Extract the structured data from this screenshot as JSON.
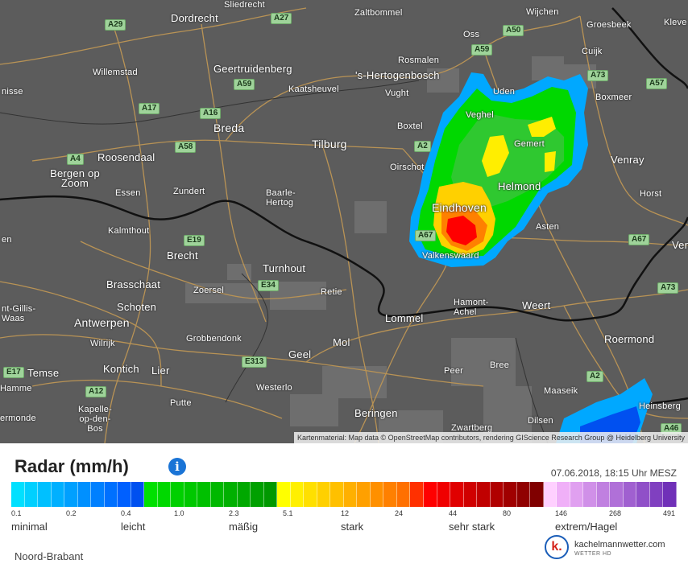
{
  "map": {
    "attribution": "Kartenmaterial: Map data © OpenStreetMap contributors, rendering GIScience Research Group @ Heidelberg University",
    "cities": [
      "Sliedrecht",
      "Dordrecht",
      "Zaltbommel",
      "Wijchen",
      "Kleve",
      "Oss",
      "Groesbeek",
      "Willemstad",
      "Geertruidenberg",
      "Rosmalen",
      "'s-Hertogenbosch",
      "Cuijk",
      "nisse",
      "Kaatsheuvel",
      "Vught",
      "Uden",
      "Boxmeer",
      "Breda",
      "Veghel",
      "Tilburg",
      "Boxtel",
      "Gemert",
      "Roosendaal",
      "Bergen op Zoom",
      "Oirschot",
      "Venray",
      "Essen",
      "Zundert",
      "Baarle-Hertog",
      "Helmond",
      "Horst",
      "Eindhoven",
      "Kalmthout",
      "Asten",
      "Brecht",
      "Valkenswaard",
      "Venlo",
      "Turnhout",
      "Brasschaat",
      "Zoersel",
      "Retie",
      "Schoten",
      "Hamont-Achel",
      "Weert",
      "nt-Gillis-Waas",
      "Antwerpen",
      "Lommel",
      "Wilrijk",
      "Grobbendonk",
      "Roermond",
      "Mol",
      "Geel",
      "Temse",
      "Kontich",
      "Lier",
      "Peer",
      "Bree",
      "Hamme",
      "Westerlo",
      "Maaseik",
      "Putte",
      "Kapelle-op-den-Bos",
      "Heinsberg",
      "Beringen",
      "Dilsen",
      "ermonde",
      "Zwartberg",
      "en"
    ],
    "roads": [
      "A29",
      "A27",
      "A50",
      "A59",
      "A73",
      "A57",
      "A59",
      "A17",
      "A16",
      "A58",
      "A4",
      "A2",
      "E19",
      "E34",
      "A67",
      "A67",
      "A73",
      "E313",
      "E17",
      "A12",
      "A2",
      "A46"
    ]
  },
  "legend": {
    "title": "Radar (mm/h)",
    "timestamp": "07.06.2018, 18:15 Uhr MESZ",
    "ticks": [
      "0.1",
      "0.2",
      "0.4",
      "1.0",
      "2.3",
      "5.1",
      "12",
      "24",
      "44",
      "80",
      "146",
      "268",
      "491"
    ],
    "categories": [
      "minimal",
      "leicht",
      "mäßig",
      "stark",
      "sehr stark",
      "extrem/Hagel"
    ],
    "colors": [
      "#00e0ff",
      "#00d0ff",
      "#00c0ff",
      "#00b0ff",
      "#00a0ff",
      "#0090ff",
      "#0080ff",
      "#0070ff",
      "#0060ff",
      "#0050f0",
      "#00e000",
      "#00d800",
      "#00d000",
      "#00c800",
      "#00c000",
      "#00b800",
      "#00b000",
      "#00a800",
      "#00a000",
      "#009800",
      "#ffff00",
      "#fff000",
      "#ffe000",
      "#ffd000",
      "#ffc000",
      "#ffb000",
      "#ffa000",
      "#ff9000",
      "#ff8000",
      "#ff7000",
      "#ff3000",
      "#ff0000",
      "#f00000",
      "#e00000",
      "#d00000",
      "#c00000",
      "#b00000",
      "#a00000",
      "#900000",
      "#800000",
      "#ffd0ff",
      "#f0b0f8",
      "#e0a0f0",
      "#d090e8",
      "#c080e0",
      "#b070d8",
      "#a060d0",
      "#9050c8",
      "#8040c0",
      "#7030b8"
    ],
    "region": "Noord-Brabant",
    "brand_name": "kachelmannwetter.com",
    "brand_sub": "WETTER HD",
    "brand_logo": "k.",
    "info_icon": "i"
  }
}
